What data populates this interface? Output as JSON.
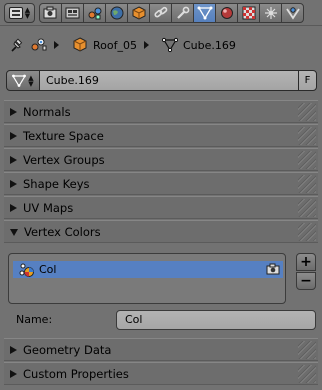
{
  "tabs": [
    {
      "name": "render-icon",
      "active": false
    },
    {
      "name": "render-layers-icon",
      "active": false
    },
    {
      "name": "scene-icon",
      "active": false
    },
    {
      "name": "world-icon",
      "active": false
    },
    {
      "name": "object-icon",
      "active": false
    },
    {
      "name": "constraints-icon",
      "active": false
    },
    {
      "name": "modifiers-icon",
      "active": false
    },
    {
      "name": "mesh-data-icon",
      "active": true
    },
    {
      "name": "material-icon",
      "active": false
    },
    {
      "name": "texture-icon",
      "active": false
    },
    {
      "name": "particles-icon",
      "active": false
    },
    {
      "name": "physics-icon",
      "active": false
    }
  ],
  "breadcrumb": {
    "object": "Roof_05",
    "mesh": "Cube.169"
  },
  "datablock": {
    "name": "Cube.169",
    "fake_user": "F"
  },
  "panels": {
    "normals": "Normals",
    "texture_space": "Texture Space",
    "vertex_groups": "Vertex Groups",
    "shape_keys": "Shape Keys",
    "uv_maps": "UV Maps",
    "vertex_colors": "Vertex Colors",
    "geometry_data": "Geometry Data",
    "custom_properties": "Custom Properties"
  },
  "vertex_colors": {
    "items": [
      "Col"
    ],
    "add": "+",
    "remove": "−",
    "name_label": "Name:",
    "name_value": "Col"
  },
  "colors": {
    "accent": "#5680c2",
    "panel": "#6d6d6d",
    "background": "#727272"
  }
}
